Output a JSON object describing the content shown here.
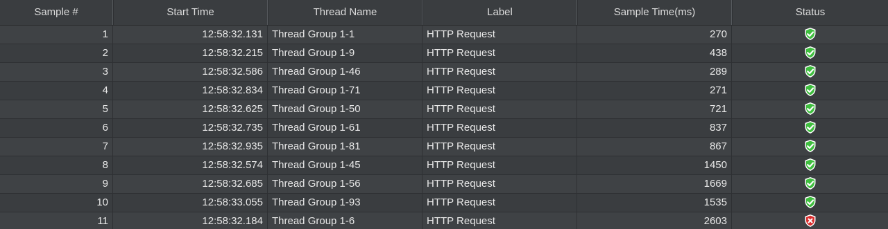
{
  "columns": [
    "Sample #",
    "Start Time",
    "Thread Name",
    "Label",
    "Sample Time(ms)",
    "Status"
  ],
  "rows": [
    {
      "sample": "1",
      "start": "12:58:32.131",
      "thread": "Thread Group 1-1",
      "label": "HTTP Request",
      "time": "270",
      "status": "success"
    },
    {
      "sample": "2",
      "start": "12:58:32.215",
      "thread": "Thread Group 1-9",
      "label": "HTTP Request",
      "time": "438",
      "status": "success"
    },
    {
      "sample": "3",
      "start": "12:58:32.586",
      "thread": "Thread Group 1-46",
      "label": "HTTP Request",
      "time": "289",
      "status": "success"
    },
    {
      "sample": "4",
      "start": "12:58:32.834",
      "thread": "Thread Group 1-71",
      "label": "HTTP Request",
      "time": "271",
      "status": "success"
    },
    {
      "sample": "5",
      "start": "12:58:32.625",
      "thread": "Thread Group 1-50",
      "label": "HTTP Request",
      "time": "721",
      "status": "success"
    },
    {
      "sample": "6",
      "start": "12:58:32.735",
      "thread": "Thread Group 1-61",
      "label": "HTTP Request",
      "time": "837",
      "status": "success"
    },
    {
      "sample": "7",
      "start": "12:58:32.935",
      "thread": "Thread Group 1-81",
      "label": "HTTP Request",
      "time": "867",
      "status": "success"
    },
    {
      "sample": "8",
      "start": "12:58:32.574",
      "thread": "Thread Group 1-45",
      "label": "HTTP Request",
      "time": "1450",
      "status": "success"
    },
    {
      "sample": "9",
      "start": "12:58:32.685",
      "thread": "Thread Group 1-56",
      "label": "HTTP Request",
      "time": "1669",
      "status": "success"
    },
    {
      "sample": "10",
      "start": "12:58:33.055",
      "thread": "Thread Group 1-93",
      "label": "HTTP Request",
      "time": "1535",
      "status": "success"
    },
    {
      "sample": "11",
      "start": "12:58:32.184",
      "thread": "Thread Group 1-6",
      "label": "HTTP Request",
      "time": "2603",
      "status": "error"
    }
  ],
  "icons": {
    "success": "success-shield-icon",
    "error": "error-shield-icon"
  },
  "colors": {
    "success": "#3fbf3f",
    "error": "#d93030"
  }
}
